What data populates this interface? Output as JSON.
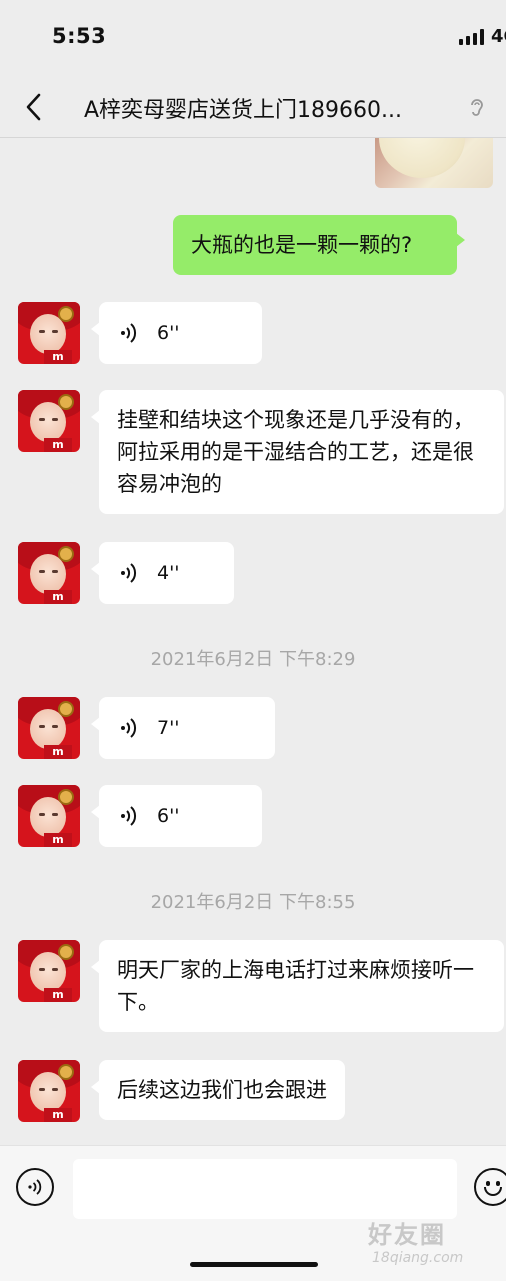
{
  "status_bar": {
    "time": "5:53",
    "network": "4G"
  },
  "header": {
    "title": "A梓奕母婴店送货上门189660..."
  },
  "messages": {
    "out1": "大瓶的也是一颗一颗的?",
    "voice1": "6''",
    "text1": "挂壁和结块这个现象还是几乎没有的，阿拉采用的是干湿结合的工艺，还是很容易冲泡的",
    "voice2": "4''",
    "ts1": "2021年6月2日 下午8:29",
    "voice3": "7''",
    "voice4": "6''",
    "ts2": "2021年6月2日 下午8:55",
    "text2": "明天厂家的上海电话打过来麻烦接听一下。",
    "text3": "后续这边我们也会跟进"
  },
  "input": {
    "placeholder": ""
  },
  "watermark": {
    "text": "好友圈",
    "sub": "18qiang.com"
  },
  "colors": {
    "outgoing_bubble": "#95ec69",
    "incoming_bubble": "#ffffff",
    "background": "#ededed"
  }
}
